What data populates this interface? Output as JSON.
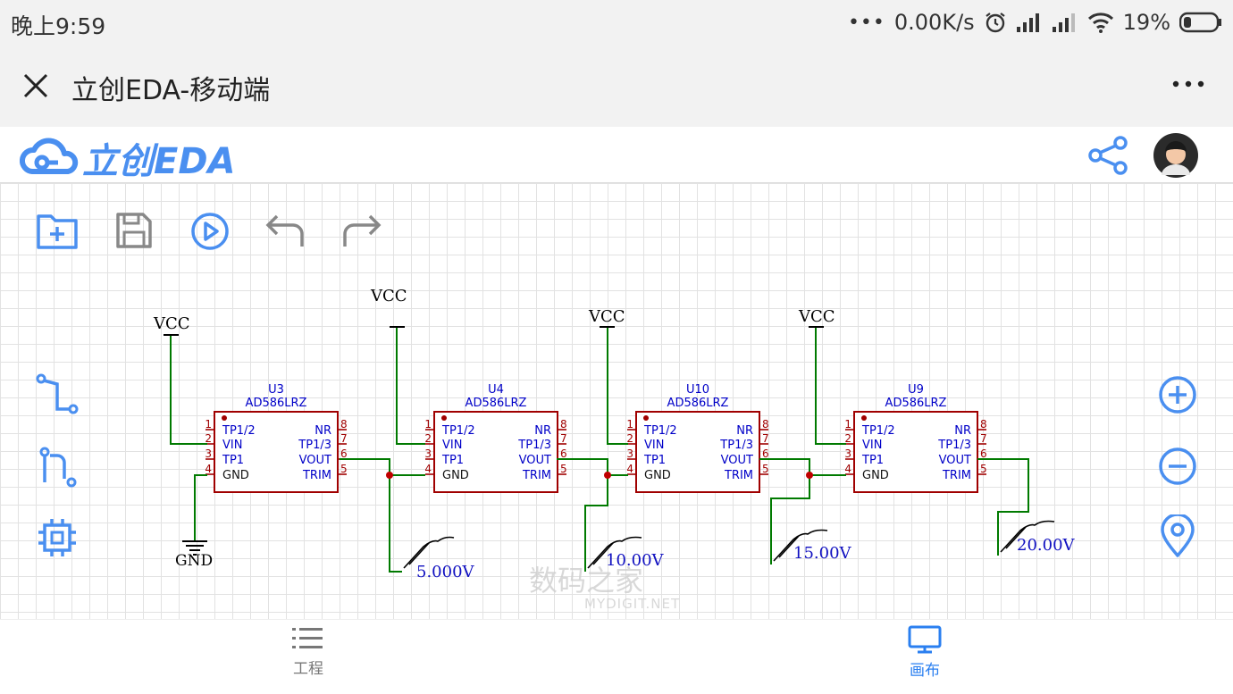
{
  "status": {
    "time": "晚上9:59",
    "network_speed": "0.00K/s",
    "battery": "19%"
  },
  "window": {
    "title": "立创EDA-移动端"
  },
  "app": {
    "logo_text": "立创EDA"
  },
  "colors": {
    "accent": "#4a8ff0",
    "wire": "#007a00",
    "component": "#a00000",
    "pin_text": "#0000c8"
  },
  "schematic": {
    "components": [
      {
        "ref": "U3",
        "part": "AD586LRZ"
      },
      {
        "ref": "U4",
        "part": "AD586LRZ"
      },
      {
        "ref": "U10",
        "part": "AD586LRZ"
      },
      {
        "ref": "U9",
        "part": "AD586LRZ"
      }
    ],
    "pins_left": [
      {
        "num": "1",
        "name": "TP1/2"
      },
      {
        "num": "2",
        "name": "VIN"
      },
      {
        "num": "3",
        "name": "TP1"
      },
      {
        "num": "4",
        "name": "GND"
      }
    ],
    "pins_right": [
      {
        "num": "8",
        "name": "NR"
      },
      {
        "num": "7",
        "name": "TP1/3"
      },
      {
        "num": "6",
        "name": "VOUT"
      },
      {
        "num": "5",
        "name": "TRIM"
      }
    ],
    "power_label": "VCC",
    "ground_label": "GND",
    "probe_values": [
      "5.000V",
      "10.00V",
      "15.00V",
      "20.00V"
    ]
  },
  "watermark": {
    "text": "数码之家",
    "sub": "MYDIGIT.NET"
  },
  "nav": {
    "project": "工程",
    "canvas": "画布"
  }
}
